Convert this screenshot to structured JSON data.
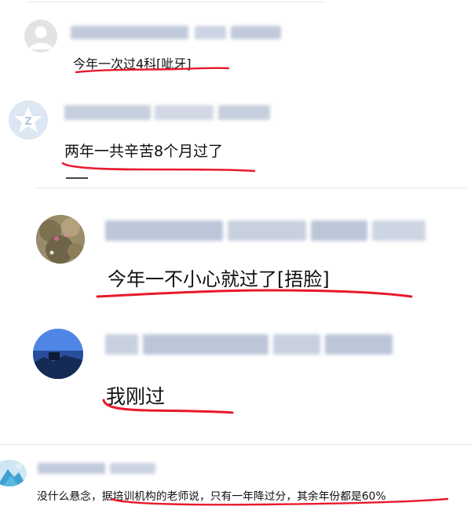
{
  "comments": [
    {
      "text": "今年一次过4科[呲牙]",
      "avatar": "default-user-icon"
    },
    {
      "text": "两年一共辛苦8个月过了",
      "avatar": "logo-badge-icon"
    },
    {
      "text": "今年一不小心就过了[捂脸]",
      "avatar": "landscape-photo-icon"
    },
    {
      "text": "我刚过",
      "avatar": "night-sky-photo-icon"
    },
    {
      "text": "没什么悬念，据培训机构的老师说，只有一年降过分，其余年份都是60%",
      "avatar": "mountain-photo-icon"
    }
  ],
  "colors": {
    "highlight": "#e8192c",
    "username_blur": "#b9c4d6",
    "divider": "#e8e8e8"
  }
}
